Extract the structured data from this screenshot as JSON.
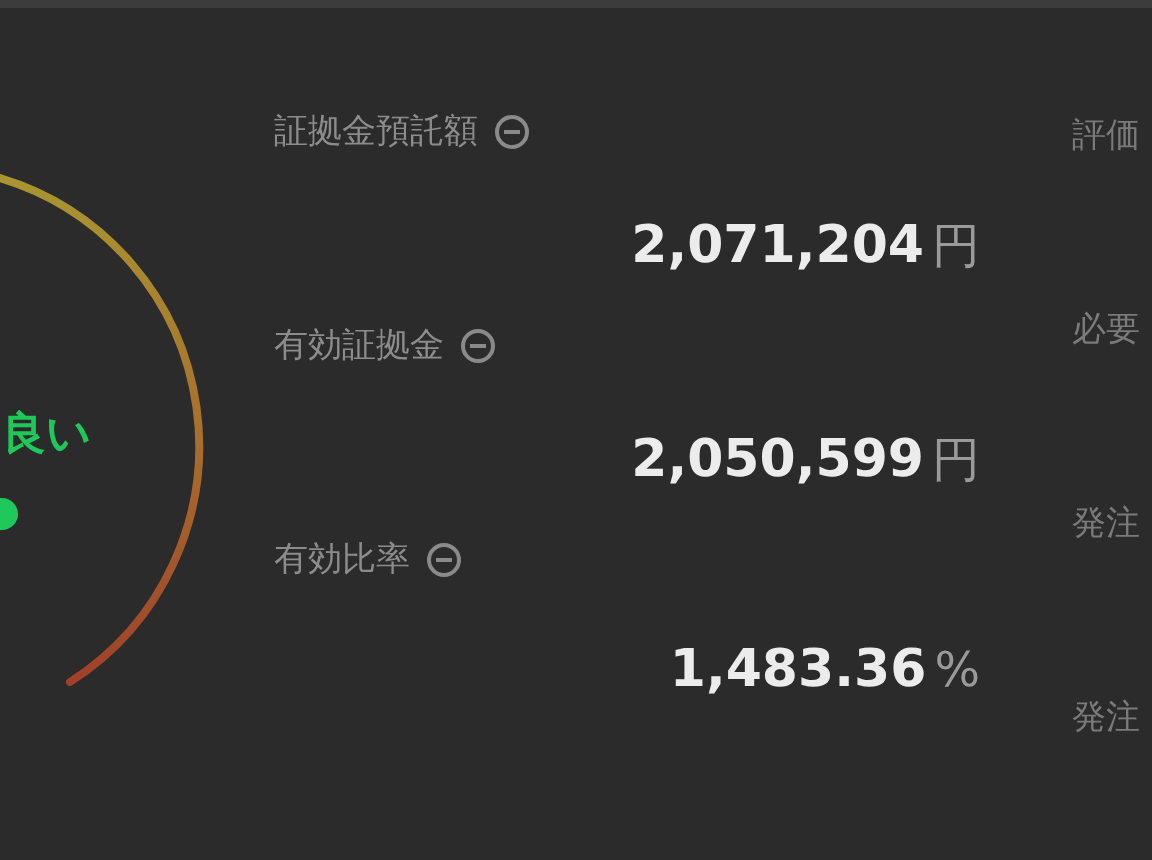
{
  "gauge": {
    "status": "良い"
  },
  "metrics": [
    {
      "label": "証拠金預託額",
      "value": "2,071,204",
      "unit": "円"
    },
    {
      "label": "有効証拠金",
      "value": "2,050,599",
      "unit": "円"
    },
    {
      "label": "有効比率",
      "value": "1,483.36",
      "unit": "%"
    }
  ],
  "column_3": [
    "評価",
    "必要",
    "発注",
    "発注"
  ]
}
